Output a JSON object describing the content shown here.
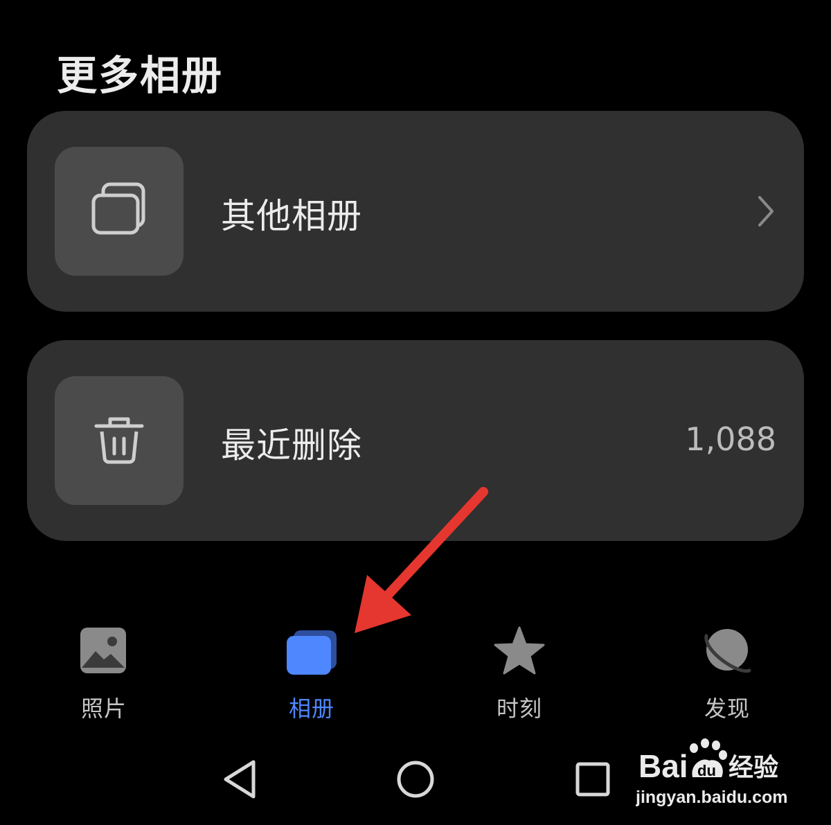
{
  "section_title": "更多相册",
  "albums": [
    {
      "label": "其他相册",
      "icon": "albums-stack-icon",
      "action_icon": "chevron-right-icon"
    },
    {
      "label": "最近删除",
      "icon": "trash-icon",
      "count": "1,088"
    }
  ],
  "tabs": [
    {
      "label": "照片",
      "icon": "photo-icon",
      "active": false
    },
    {
      "label": "相册",
      "icon": "album-icon",
      "active": true
    },
    {
      "label": "时刻",
      "icon": "star-icon",
      "active": false
    },
    {
      "label": "发现",
      "icon": "planet-icon",
      "active": false
    }
  ],
  "system_nav": [
    "back-icon",
    "home-icon",
    "recents-icon"
  ],
  "watermark": {
    "brand": "Bai du 经验",
    "url": "jingyan.baidu.com"
  },
  "colors": {
    "background": "#000000",
    "card": "#303030",
    "thumb": "#4b4b4b",
    "accent": "#4f87ff",
    "annotation_arrow": "#e5372f"
  }
}
